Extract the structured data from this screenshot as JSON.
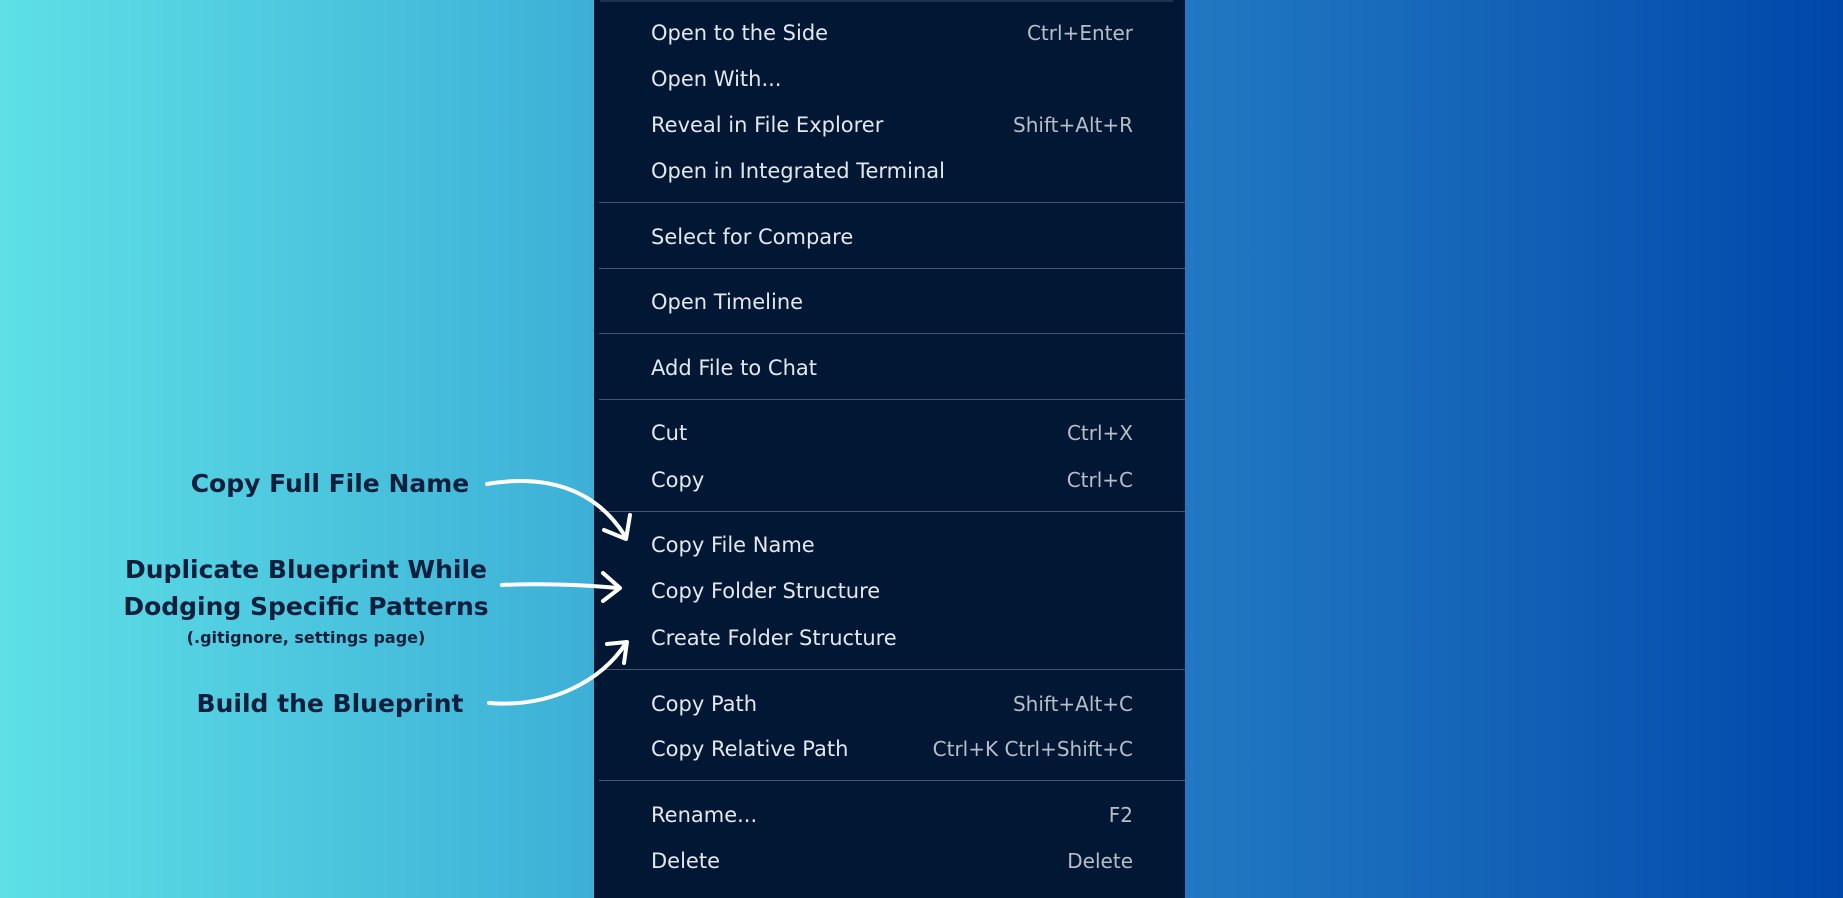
{
  "menu": {
    "groups": [
      [
        {
          "label": "Open to the Side",
          "shortcut": "Ctrl+Enter"
        },
        {
          "label": "Open With...",
          "shortcut": ""
        },
        {
          "label": "Reveal in File Explorer",
          "shortcut": "Shift+Alt+R"
        },
        {
          "label": "Open in Integrated Terminal",
          "shortcut": ""
        }
      ],
      [
        {
          "label": "Select for Compare",
          "shortcut": ""
        }
      ],
      [
        {
          "label": "Open Timeline",
          "shortcut": ""
        }
      ],
      [
        {
          "label": "Add File to Chat",
          "shortcut": ""
        }
      ],
      [
        {
          "label": "Cut",
          "shortcut": "Ctrl+X"
        },
        {
          "label": "Copy",
          "shortcut": "Ctrl+C"
        }
      ],
      [
        {
          "label": "Copy File Name",
          "shortcut": ""
        },
        {
          "label": "Copy Folder Structure",
          "shortcut": ""
        },
        {
          "label": "Create Folder Structure",
          "shortcut": ""
        }
      ],
      [
        {
          "label": "Copy Path",
          "shortcut": "Shift+Alt+C"
        },
        {
          "label": "Copy Relative Path",
          "shortcut": "Ctrl+K Ctrl+Shift+C"
        }
      ],
      [
        {
          "label": "Rename...",
          "shortcut": "F2"
        },
        {
          "label": "Delete",
          "shortcut": "Delete"
        }
      ]
    ]
  },
  "annotations": {
    "copy_full_file_name": "Copy Full File Name",
    "duplicate_line1": "Duplicate Blueprint While",
    "duplicate_line2": "Dodging Specific Patterns",
    "duplicate_sub": "(.gitignore, settings page)",
    "build_blueprint": "Build the Blueprint"
  },
  "colors": {
    "menu_background": "#011733",
    "menu_text": "#e4e8ee",
    "shortcut_text": "#b7bec8",
    "separator": "#46556b",
    "annotation_text": "#0d1f3c",
    "arrow": "#ffffff"
  }
}
